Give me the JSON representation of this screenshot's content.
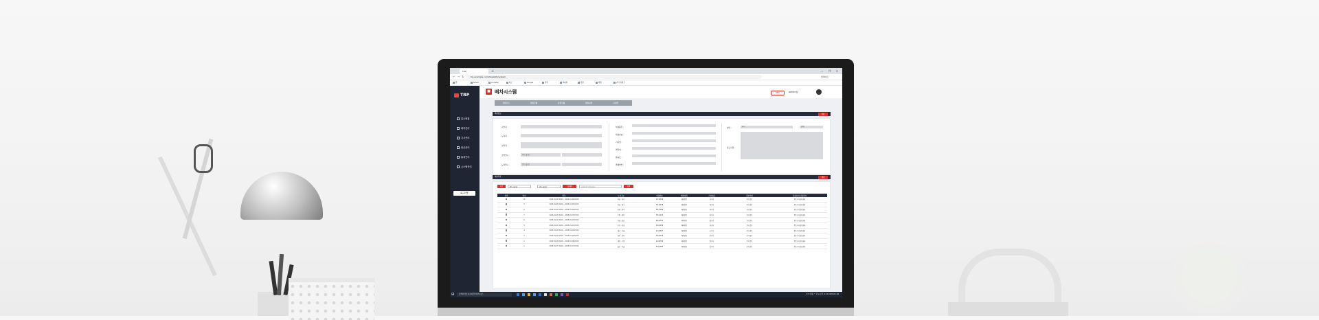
{
  "browser": {
    "tab_title": "TRP",
    "new_tab": "+",
    "window_controls": "— ❐ ✕",
    "nav": "← → ↻",
    "url": "trp.example.com/dispatch/system",
    "profile": "업데이트",
    "bookmarks": [
      "앱",
      "Gmail",
      "YouTube",
      "지도",
      "Google",
      "번역",
      "네이버",
      "검색",
      "메일",
      "기타 북마크"
    ]
  },
  "sidebar": {
    "logo": "TRP",
    "items": [
      {
        "label": "접수현황",
        "icon": "list-icon"
      },
      {
        "label": "배차관리",
        "icon": "truck-icon"
      },
      {
        "label": "기사관리",
        "icon": "user-icon"
      },
      {
        "label": "정산관리",
        "icon": "calc-icon"
      },
      {
        "label": "통계관리",
        "icon": "chart-icon"
      },
      {
        "label": "시스템관리",
        "icon": "gear-icon"
      }
    ],
    "logout": "로그아웃"
  },
  "header": {
    "title": "배차시스템",
    "badge": "NEW",
    "user": "admin님"
  },
  "top_tabs": [
    "배차접수",
    "배차현황",
    "운행현황",
    "배차내역",
    "기사별"
  ],
  "form_section": {
    "title": "배차정보",
    "save_button": "저장",
    "left_labels": [
      "출발지 :",
      "도착지 :",
      "경유지 :",
      "출발일시 :",
      "도착일시 :"
    ],
    "date_value": "연도-월-일",
    "mid_labels": [
      "차량종류 :",
      "차량번호 :",
      "기사명 :",
      "연락처 :",
      "운송료 :",
      "결제방법 :"
    ],
    "right_labels": [
      "상태 :",
      "참고사항 :"
    ],
    "status_value": "대기",
    "status_option2": "전체"
  },
  "list_section": {
    "title": "배차목록",
    "excel_button": "엑셀",
    "period_button": "기간",
    "date_from": "연도-월-일",
    "date_to": "연도-월-일",
    "today_button": "오늘배차",
    "search_placeholder": "검색어를 입력하세요",
    "search_button": "검색",
    "columns": [
      "선택",
      "번호",
      "일자",
      "노선구분",
      "차량번호",
      "배차상태",
      "기사이름",
      "접수처명",
      "운송기사 담당회사"
    ],
    "rows": [
      {
        "no": "10",
        "date": "2023-01-26 09:00 ~ 2023-01-26 18:00",
        "route": "서울 - 부산",
        "car": "12가3456",
        "status": "배차완료",
        "driver": "김기사",
        "office": "본사 접수",
        "company": "운송기사 담당회사"
      },
      {
        "no": "9",
        "date": "2023-01-25 09:00 ~ 2023-01-25 18:00",
        "route": "서울 - 대구",
        "car": "34나5678",
        "status": "배차완료",
        "driver": "이기사",
        "office": "본사 접수",
        "company": "운송기사 담당회사"
      },
      {
        "no": "8",
        "date": "2023-01-24 09:00 ~ 2023-01-24 18:00",
        "route": "인천 - 광주",
        "car": "56다7890",
        "status": "배차완료",
        "driver": "박기사",
        "office": "본사 접수",
        "company": "운송기사 담당회사"
      },
      {
        "no": "7",
        "date": "2023-01-23 09:00 ~ 2023-01-23 18:00",
        "route": "수원 - 대전",
        "car": "78라1234",
        "status": "배차완료",
        "driver": "최기사",
        "office": "본사 접수",
        "company": "운송기사 담당회사"
      },
      {
        "no": "6",
        "date": "2023-01-22 09:00 ~ 2023-01-22 18:00",
        "route": "서울 - 울산",
        "car": "90마2345",
        "status": "배차완료",
        "driver": "정기사",
        "office": "본사 접수",
        "company": "운송기사 담당회사"
      },
      {
        "no": "5",
        "date": "2023-01-21 09:00 ~ 2023-01-21 18:00",
        "route": "부산 - 서울",
        "car": "11바3456",
        "status": "배차완료",
        "driver": "강기사",
        "office": "본사 접수",
        "company": "운송기사 담당회사"
      },
      {
        "no": "4",
        "date": "2023-01-20 09:00 ~ 2023-01-20 18:00",
        "route": "대구 - 서울",
        "car": "22사4567",
        "status": "배차완료",
        "driver": "조기사",
        "office": "본사 접수",
        "company": "운송기사 담당회사"
      },
      {
        "no": "3",
        "date": "2023-01-19 09:00 ~ 2023-01-19 18:00",
        "route": "광주 - 인천",
        "car": "33아5678",
        "status": "배차완료",
        "driver": "윤기사",
        "office": "본사 접수",
        "company": "운송기사 담당회사"
      },
      {
        "no": "2",
        "date": "2023-01-18 09:00 ~ 2023-01-18 18:00",
        "route": "대전 - 수원",
        "car": "44자6789",
        "status": "배차완료",
        "driver": "장기사",
        "office": "본사 접수",
        "company": "운송기사 담당회사"
      },
      {
        "no": "1",
        "date": "2023-01-17 09:00 ~ 2023-01-17 18:00",
        "route": "울산 - 서울",
        "car": "55차7890",
        "status": "배차완료",
        "driver": "임기사",
        "office": "본사 접수",
        "company": "운송기사 담당회사"
      }
    ]
  },
  "taskbar": {
    "start": "⊞",
    "search": "검색하려면 여기에 입력하십시오.",
    "tray": "2°C 맑음  ^ 한 A  오후 4:12  2023-01-26"
  },
  "colors": {
    "accent": "#d7322d",
    "dark": "#242b3b",
    "sidebar": "#1f2533"
  }
}
